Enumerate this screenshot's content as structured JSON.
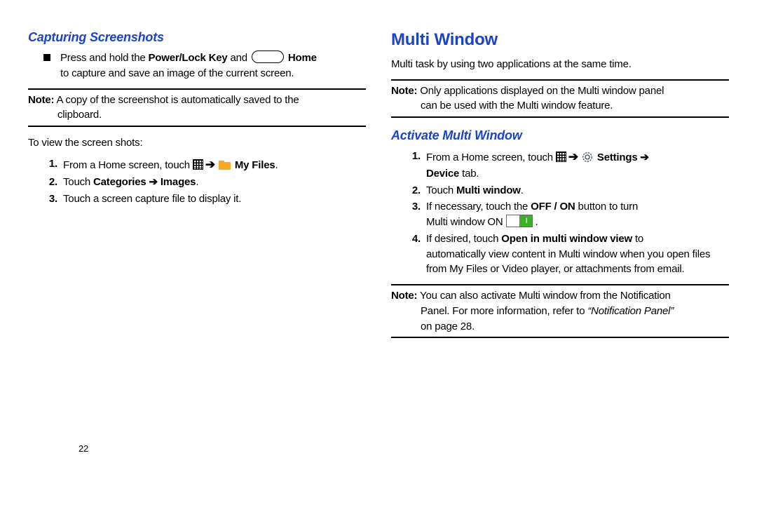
{
  "pageNumber": "22",
  "left": {
    "heading": "Capturing Screenshots",
    "bullet_pre": "Press and hold the ",
    "bullet_bold1": "Power/Lock Key",
    "bullet_mid1": " and ",
    "bullet_bold2": "Home",
    "bullet_line2": "to capture and save an image of the current screen.",
    "note_label": "Note:",
    "note_body_a": " A copy of the screenshot is automatically saved to the",
    "note_body_b": "clipboard.",
    "view_intro": "To view the screen shots:",
    "li1_pre": "From a Home screen, touch ",
    "li1_bold": "My Files",
    "li2_pre": "Touch ",
    "li2_bold": "Categories ➔ Images",
    "li3": "Touch a screen capture file to display it."
  },
  "right": {
    "heading_big": "Multi Window",
    "intro": "Multi task by using two applications at the same time.",
    "note1_label": "Note:",
    "note1_a": " Only applications displayed on the Multi window panel",
    "note1_b": "can be used with the Multi window feature.",
    "heading_sub": "Activate Multi Window",
    "li1_pre": "From a Home screen, touch ",
    "li1_bold1": "Settings ➔",
    "li1_bold2": "Device",
    "li1_tail": " tab.",
    "li2_pre": "Touch ",
    "li2_bold": "Multi window",
    "li3_a": "If necessary, touch the ",
    "li3_bold": "OFF / ON",
    "li3_b": " button to turn",
    "li3_c": "Multi window ON ",
    "li4_a": "If desired, touch ",
    "li4_bold": "Open in multi window view",
    "li4_b": " to",
    "li4_c": "automatically view content in Multi window when you open files from My Files or Video player, or attachments from email.",
    "note2_label": "Note:",
    "note2_a": " You can also activate Multi window from the Notification",
    "note2_b": "Panel. For more information, refer to ",
    "note2_ital": "“Notification Panel”",
    "note2_c": "on page 28."
  }
}
